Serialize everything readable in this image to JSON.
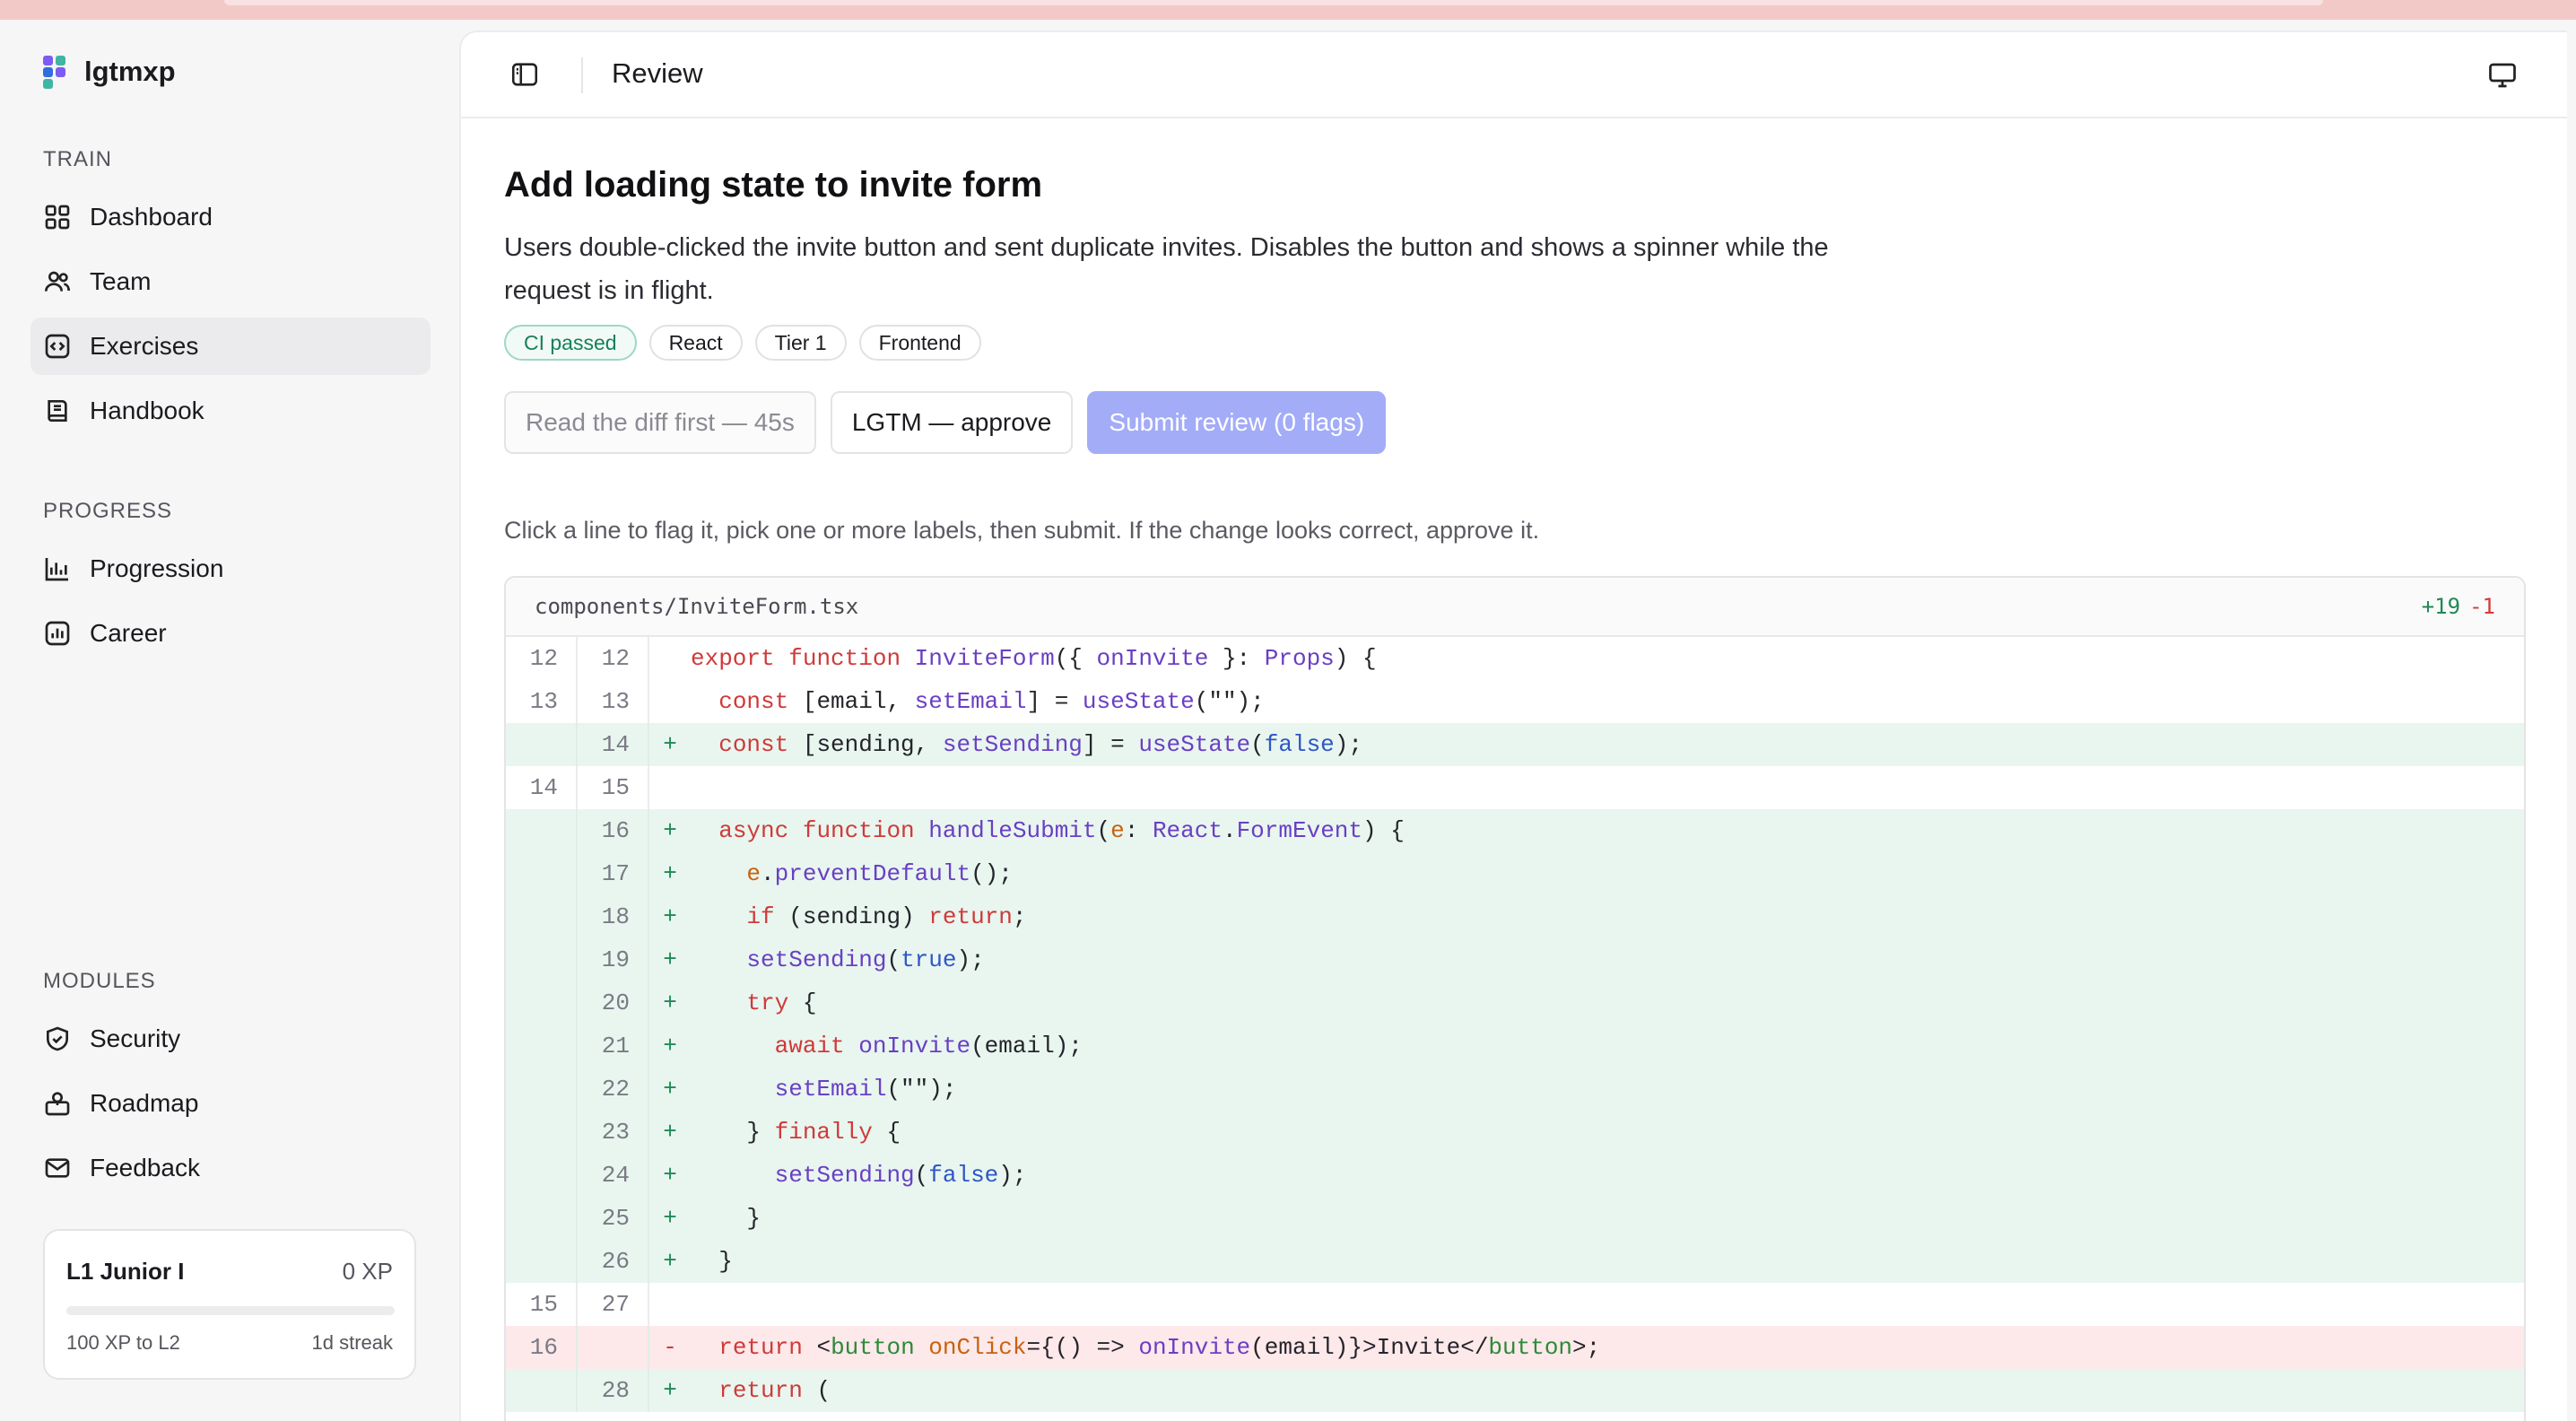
{
  "app": {
    "name": "lgtmxp"
  },
  "sidebar": {
    "sections": [
      {
        "label": "TRAIN",
        "items": [
          {
            "label": "Dashboard",
            "icon": "grid-icon",
            "active": false
          },
          {
            "label": "Team",
            "icon": "users-icon",
            "active": false
          },
          {
            "label": "Exercises",
            "icon": "code-icon",
            "active": true
          },
          {
            "label": "Handbook",
            "icon": "book-icon",
            "active": false
          }
        ]
      },
      {
        "label": "PROGRESS",
        "items": [
          {
            "label": "Progression",
            "icon": "bar-chart-icon",
            "active": false
          },
          {
            "label": "Career",
            "icon": "chart-box-icon",
            "active": false
          }
        ]
      },
      {
        "label": "MODULES",
        "items": [
          {
            "label": "Security",
            "icon": "shield-icon",
            "active": false
          },
          {
            "label": "Roadmap",
            "icon": "map-icon",
            "active": false
          },
          {
            "label": "Feedback",
            "icon": "mail-icon",
            "active": false
          }
        ]
      }
    ],
    "level": {
      "title": "L1 Junior I",
      "xp": "0 XP",
      "to_next": "100 XP to L2",
      "streak": "1d streak",
      "progress": 0
    }
  },
  "header": {
    "title": "Review"
  },
  "exercise": {
    "title": "Add loading state to invite form",
    "description": "Users double-clicked the invite button and sent duplicate invites. Disables the button and shows a spinner while the request is in flight.",
    "tags": [
      "CI passed",
      "React",
      "Tier 1",
      "Frontend"
    ],
    "actions": {
      "read_first": "Read the diff first — 45s",
      "approve": "LGTM — approve",
      "submit": "Submit review (0 flags)"
    },
    "hint": "Click a line to flag it, pick one or more labels, then submit. If the change looks correct, approve it."
  },
  "diff": {
    "file": "components/InviteForm.tsx",
    "additions": "+19",
    "deletions": "-1",
    "lines": [
      {
        "old": "12",
        "new": "12",
        "type": "ctx",
        "sign": "",
        "code": "export function InviteForm({ onInvite }: Props) {"
      },
      {
        "old": "13",
        "new": "13",
        "type": "ctx",
        "sign": "",
        "code": "  const [email, setEmail] = useState(\"\");"
      },
      {
        "old": "",
        "new": "14",
        "type": "add",
        "sign": "+",
        "code": "  const [sending, setSending] = useState(false);"
      },
      {
        "old": "14",
        "new": "15",
        "type": "ctx",
        "sign": "",
        "code": ""
      },
      {
        "old": "",
        "new": "16",
        "type": "add",
        "sign": "+",
        "code": "  async function handleSubmit(e: React.FormEvent) {"
      },
      {
        "old": "",
        "new": "17",
        "type": "add",
        "sign": "+",
        "code": "    e.preventDefault();"
      },
      {
        "old": "",
        "new": "18",
        "type": "add",
        "sign": "+",
        "code": "    if (sending) return;"
      },
      {
        "old": "",
        "new": "19",
        "type": "add",
        "sign": "+",
        "code": "    setSending(true);"
      },
      {
        "old": "",
        "new": "20",
        "type": "add",
        "sign": "+",
        "code": "    try {"
      },
      {
        "old": "",
        "new": "21",
        "type": "add",
        "sign": "+",
        "code": "      await onInvite(email);"
      },
      {
        "old": "",
        "new": "22",
        "type": "add",
        "sign": "+",
        "code": "      setEmail(\"\");"
      },
      {
        "old": "",
        "new": "23",
        "type": "add",
        "sign": "+",
        "code": "    } finally {"
      },
      {
        "old": "",
        "new": "24",
        "type": "add",
        "sign": "+",
        "code": "      setSending(false);"
      },
      {
        "old": "",
        "new": "25",
        "type": "add",
        "sign": "+",
        "code": "    }"
      },
      {
        "old": "",
        "new": "26",
        "type": "add",
        "sign": "+",
        "code": "  }"
      },
      {
        "old": "15",
        "new": "27",
        "type": "ctx",
        "sign": "",
        "code": ""
      },
      {
        "old": "16",
        "new": "",
        "type": "del",
        "sign": "-",
        "code": "  return <button onClick={() => onInvite(email)}>Invite</button>;"
      },
      {
        "old": "",
        "new": "28",
        "type": "add",
        "sign": "+",
        "code": "  return ("
      }
    ]
  }
}
